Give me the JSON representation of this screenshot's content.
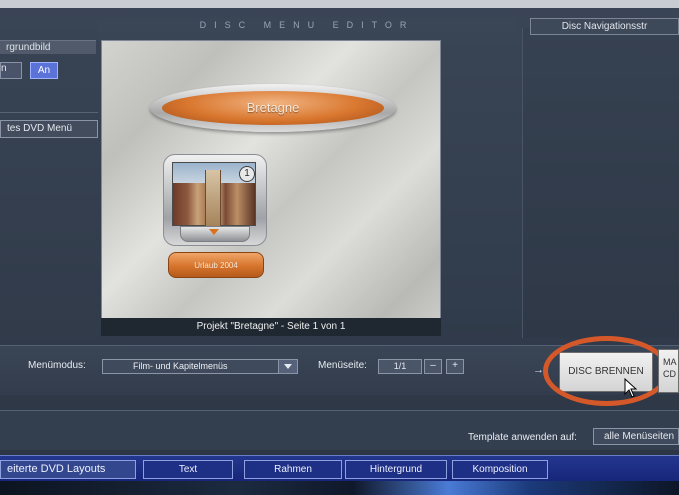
{
  "window": {
    "title": "DISC MENU EDITOR"
  },
  "left_panel": {
    "background_label": "rgrundbild",
    "off_label": "n",
    "on_label": "An",
    "dvd_menu_label": "tes DVD Menü"
  },
  "editor": {
    "menu_title": "Bretagne",
    "chapter_badge": "1",
    "chapter_label": "Urlaub 2004",
    "caption": "Projekt \"Bretagne\" - Seite 1 von 1"
  },
  "right_panel": {
    "header": "Disc Navigationsstr"
  },
  "controls": {
    "menu_mode_label": "Menümodus:",
    "menu_mode_value": "Film- und Kapitelmenüs",
    "menu_page_label": "Menüseite:",
    "menu_page_value": "1/1",
    "minus": "–",
    "plus": "+",
    "burn_arrow": "→",
    "burn_button": "DISC BRENNEN",
    "mac_button": "MA CD"
  },
  "template": {
    "label": "Template anwenden auf:",
    "value": "alle Menüseiten"
  },
  "tabs": [
    {
      "label": "eiterte DVD Layouts"
    },
    {
      "label": "Text"
    },
    {
      "label": "Rahmen"
    },
    {
      "label": "Hintergrund"
    },
    {
      "label": "Komposition"
    }
  ],
  "colors": {
    "accent_orange": "#d6742c",
    "highlight_circle": "#d5582a",
    "tab_bar": "#1e2f86",
    "active_toggle": "#5b72d8"
  }
}
